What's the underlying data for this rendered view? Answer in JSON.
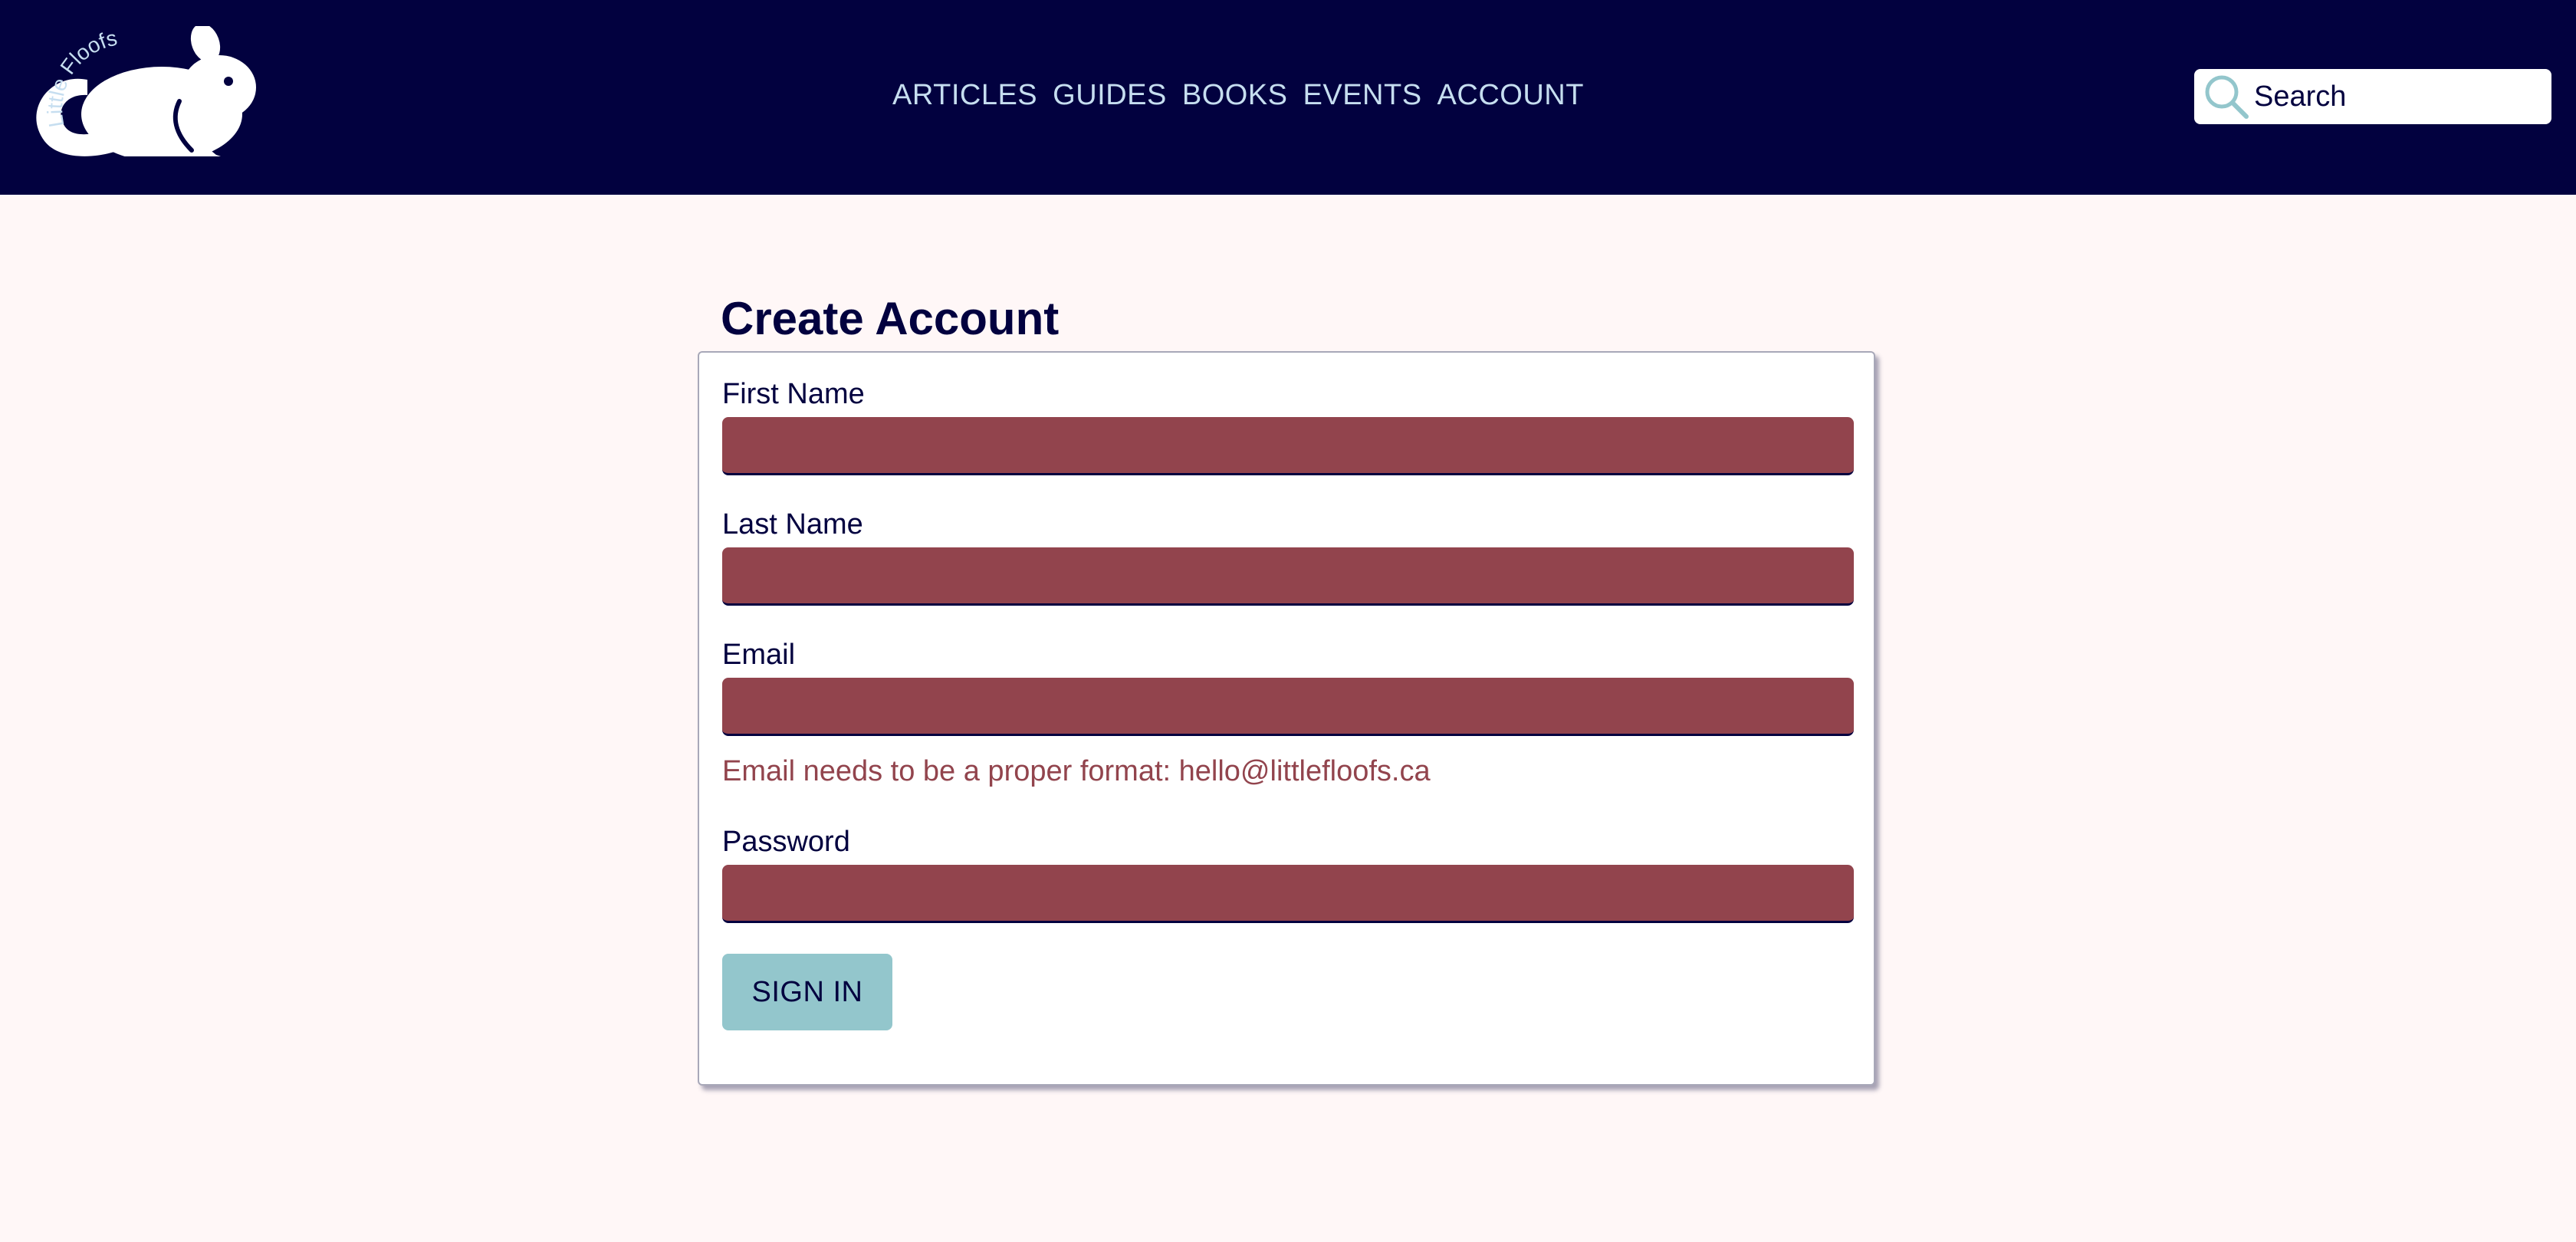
{
  "brand": {
    "logo_text": "Little Floofs"
  },
  "nav": {
    "items": [
      {
        "label": "ARTICLES"
      },
      {
        "label": "GUIDES"
      },
      {
        "label": "BOOKS"
      },
      {
        "label": "EVENTS"
      },
      {
        "label": "ACCOUNT"
      }
    ]
  },
  "search": {
    "placeholder": "Search",
    "value": ""
  },
  "form": {
    "title": "Create Account",
    "fields": {
      "first_name": {
        "label": "First Name",
        "value": ""
      },
      "last_name": {
        "label": "Last Name",
        "value": ""
      },
      "email": {
        "label": "Email",
        "value": "",
        "error": "Email needs to be a proper format: hello@littlefloofs.ca"
      },
      "password": {
        "label": "Password",
        "value": ""
      }
    },
    "submit_label": "SIGN IN"
  },
  "colors": {
    "header_bg": "#02013f",
    "page_bg": "#fff7f7",
    "nav_text": "#c6def0",
    "input_error_bg": "#92444d",
    "error_text": "#92444d",
    "button_bg": "#93c6cc",
    "search_icon": "#93c6cc"
  }
}
